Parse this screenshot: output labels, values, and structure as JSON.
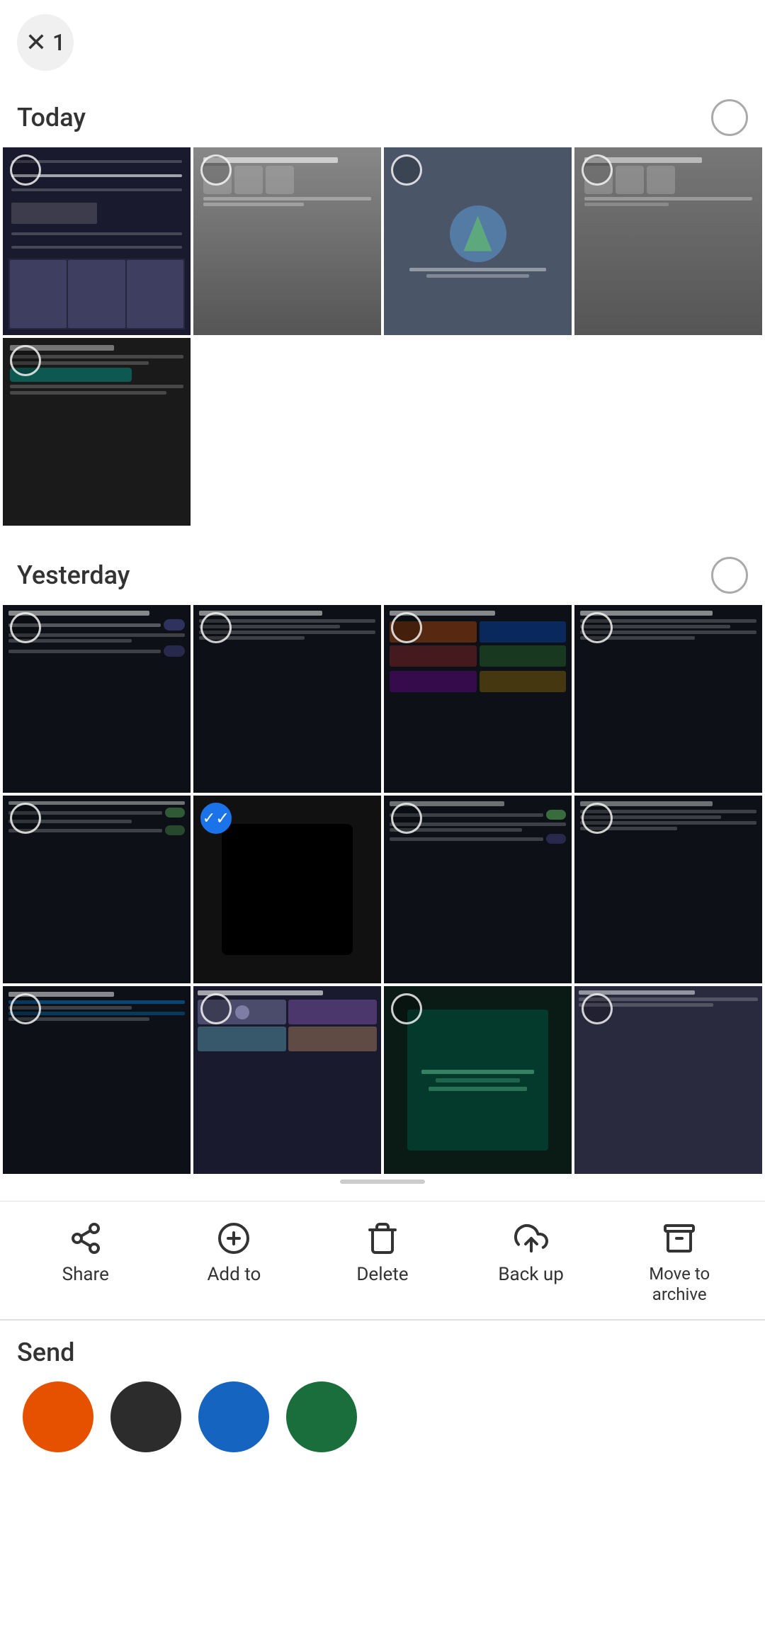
{
  "header": {
    "close_label": "×",
    "count": "1"
  },
  "sections": {
    "today": {
      "title": "Today",
      "photos": [
        {
          "id": "today-1",
          "bg": "#1a1a2e",
          "selected": false,
          "type": "dark"
        },
        {
          "id": "today-2",
          "bg": "#888",
          "selected": false,
          "type": "gray"
        },
        {
          "id": "today-3",
          "bg": "#557",
          "selected": false,
          "type": "blue-gray"
        },
        {
          "id": "today-4",
          "bg": "#888",
          "selected": false,
          "type": "gray"
        },
        {
          "id": "today-5",
          "bg": "#1a1a2e",
          "selected": false,
          "type": "dark"
        }
      ]
    },
    "yesterday": {
      "title": "Yesterday",
      "photos": [
        {
          "id": "yest-1",
          "bg": "#1a1a2e",
          "selected": false
        },
        {
          "id": "yest-2",
          "bg": "#1a1a2e",
          "selected": false
        },
        {
          "id": "yest-3",
          "bg": "#1a1a2e",
          "selected": false
        },
        {
          "id": "yest-4",
          "bg": "#1a1a2e",
          "selected": false
        },
        {
          "id": "yest-5",
          "bg": "#1a1a2e",
          "selected": false
        },
        {
          "id": "yest-6",
          "bg": "#111",
          "selected": true
        },
        {
          "id": "yest-7",
          "bg": "#1a1a2e",
          "selected": false
        },
        {
          "id": "yest-8",
          "bg": "#1a1a2e",
          "selected": false
        },
        {
          "id": "yest-9",
          "bg": "#1a1a2e",
          "selected": false
        },
        {
          "id": "yest-10",
          "bg": "#1a3a2e",
          "selected": false
        },
        {
          "id": "yest-11",
          "bg": "#1a1a2e",
          "selected": false
        },
        {
          "id": "yest-12",
          "bg": "#555",
          "selected": false
        }
      ]
    }
  },
  "toolbar": {
    "items": [
      {
        "id": "share",
        "label": "Share",
        "icon": "share"
      },
      {
        "id": "add-to",
        "label": "Add to",
        "icon": "add"
      },
      {
        "id": "delete",
        "label": "Delete",
        "icon": "delete"
      },
      {
        "id": "back-up",
        "label": "Back up",
        "icon": "backup"
      },
      {
        "id": "move-archive",
        "label": "Move to archive",
        "icon": "archive"
      }
    ]
  },
  "send": {
    "title": "Send",
    "avatars": [
      {
        "id": "avatar-1",
        "color": "#e65100"
      },
      {
        "id": "avatar-2",
        "color": "#2c2c2c"
      },
      {
        "id": "avatar-3",
        "color": "#1565c0"
      },
      {
        "id": "avatar-4",
        "color": "#1a6e3c"
      }
    ]
  }
}
